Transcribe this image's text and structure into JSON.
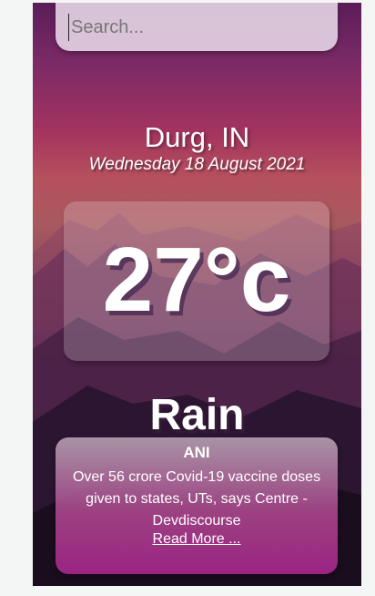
{
  "search": {
    "placeholder": "Search...",
    "value": ""
  },
  "location": {
    "city": "Durg, IN",
    "date": "Wednesday 18 August 2021"
  },
  "weather": {
    "temperature": "27°c",
    "condition": "Rain"
  },
  "news": {
    "source": "ANI",
    "headline": "Over 56 crore Covid-19 vaccine doses given to states, UTs, says Centre - Devdiscourse",
    "link_label": "Read More ..."
  },
  "colors": {
    "sky_top": "#5a1d58",
    "sky_mid": "#a3335f",
    "mountain_dark": "#24132a",
    "card_accent": "#9b2483"
  }
}
